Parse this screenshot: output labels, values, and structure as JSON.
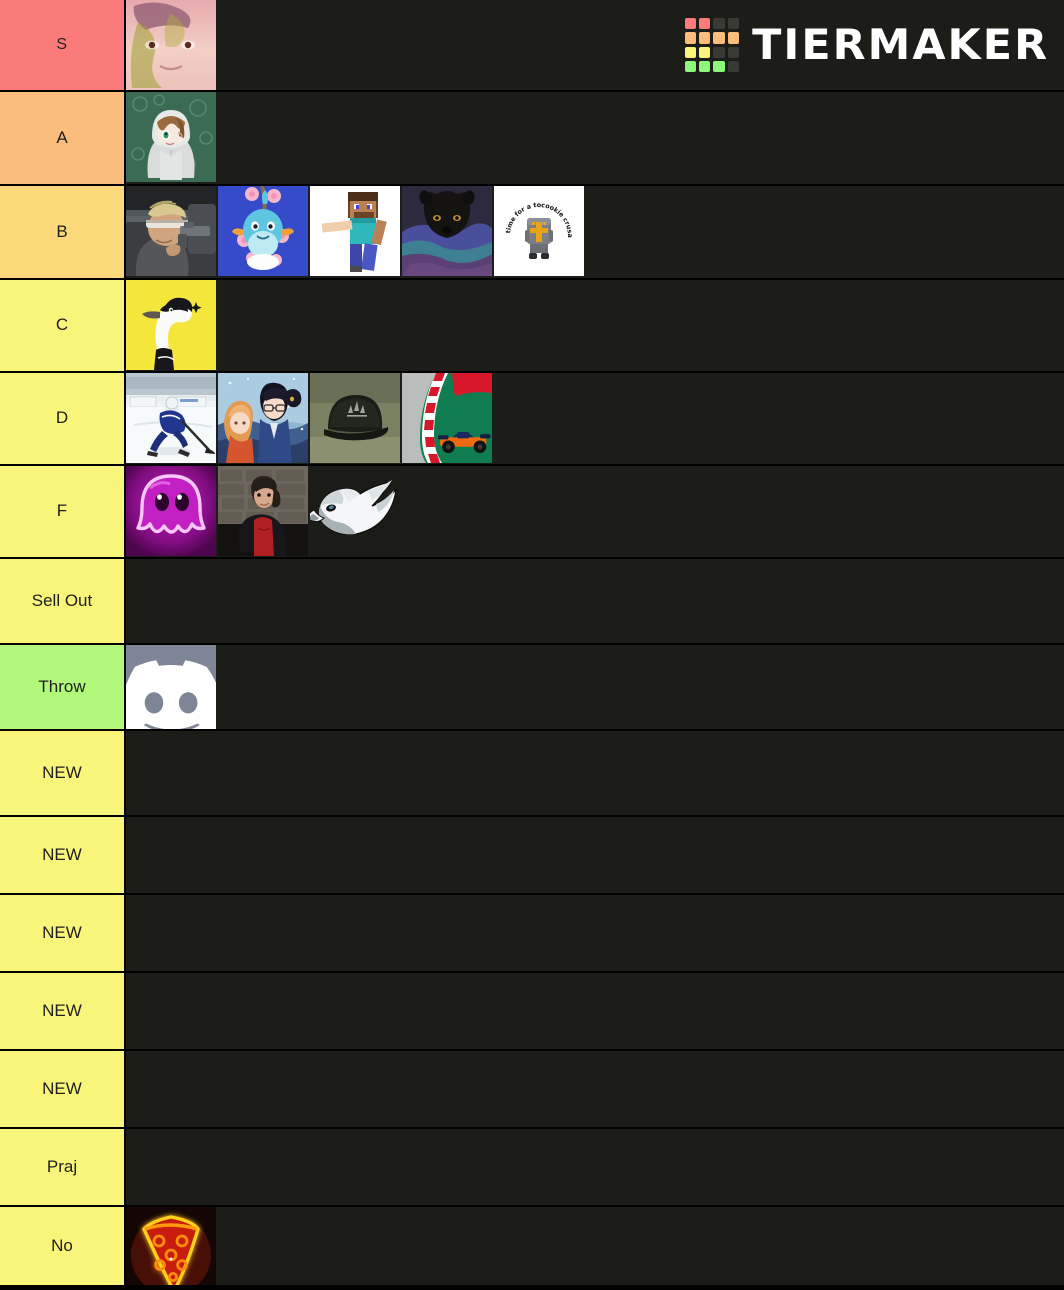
{
  "brand": {
    "name": "TIERMAKER",
    "logo_colors": {
      "red": "#fb7b7b",
      "orange": "#fbbd7b",
      "yellow": "#f9f57b",
      "green": "#8cf97b",
      "dark": "#3a3a35"
    },
    "logo_grid": [
      [
        "red",
        "red",
        "dark",
        "dark"
      ],
      [
        "orange",
        "orange",
        "orange",
        "orange"
      ],
      [
        "yellow",
        "yellow",
        "dark",
        "dark"
      ],
      [
        "green",
        "green",
        "green",
        "dark"
      ]
    ]
  },
  "board": {
    "background": "#1c1c18",
    "separator": "#000000"
  },
  "tiers": [
    {
      "label": "S",
      "color": "#fb7b7b",
      "items": [
        {
          "name": "glitched-portrait",
          "alt": "Distorted glitched portrait of a person"
        }
      ]
    },
    {
      "label": "A",
      "color": "#fbbd7b",
      "items": [
        {
          "name": "hooded-anime-character",
          "alt": "Anime character in grey hoodie on green bubble background"
        }
      ]
    },
    {
      "label": "B",
      "color": "#fbd97b",
      "items": [
        {
          "name": "anime-gunman",
          "alt": "Anime man with visor aiming a handgun"
        },
        {
          "name": "mudkip-sticker",
          "alt": "Mudkip Pokemon sticker with pink flowers"
        },
        {
          "name": "minecraft-steve",
          "alt": "Minecraft Steve character on white background"
        },
        {
          "name": "dog-in-blanket",
          "alt": "Black dog peeking over a purple blanket"
        },
        {
          "name": "crusader-meme",
          "alt": "Crusader knight meme: it's time for a tocookie crusade"
        }
      ]
    },
    {
      "label": "C",
      "color": "#f9f57b",
      "items": [
        {
          "name": "goose-illustration",
          "alt": "Goose illustration on yellow background"
        }
      ]
    },
    {
      "label": "D",
      "color": "#f9f57b",
      "items": [
        {
          "name": "ice-hockey-player",
          "alt": "Ice hockey player skating with a stick"
        },
        {
          "name": "anime-couple-snow",
          "alt": "Anime couple in the snow"
        },
        {
          "name": "adidas-snapback-cap",
          "alt": "Black Adidas snapback cap on grass"
        },
        {
          "name": "mclaren-f1-car",
          "alt": "Orange McLaren Formula 1 car on track"
        }
      ]
    },
    {
      "label": "F",
      "color": "#f9f57b",
      "items": [
        {
          "name": "purple-ghost-logo",
          "alt": "Glowing magenta ghost mascot logo"
        },
        {
          "name": "person-red-hoodie",
          "alt": "Person in red hoodie sitting against stone wall"
        },
        {
          "name": "philadelphia-eagles-logo",
          "alt": "Philadelphia Eagles team logo"
        }
      ]
    },
    {
      "label": "Sell Out",
      "color": "#f9f57b",
      "items": []
    },
    {
      "label": "Throw",
      "color": "#b2f97b",
      "items": [
        {
          "name": "discord-logo",
          "alt": "Discord logo on grey background"
        }
      ]
    },
    {
      "label": "NEW",
      "color": "#f9f57b",
      "items": []
    },
    {
      "label": "NEW",
      "color": "#f9f57b",
      "items": []
    },
    {
      "label": "NEW",
      "color": "#f9f57b",
      "items": []
    },
    {
      "label": "NEW",
      "color": "#f9f57b",
      "items": []
    },
    {
      "label": "NEW",
      "color": "#f9f57b",
      "items": []
    },
    {
      "label": "Praj",
      "color": "#f9f57b",
      "items": []
    },
    {
      "label": "No",
      "color": "#f9f57b",
      "items": [
        {
          "name": "neon-pizza-sign",
          "alt": "Neon pizza slice sign"
        }
      ]
    }
  ]
}
